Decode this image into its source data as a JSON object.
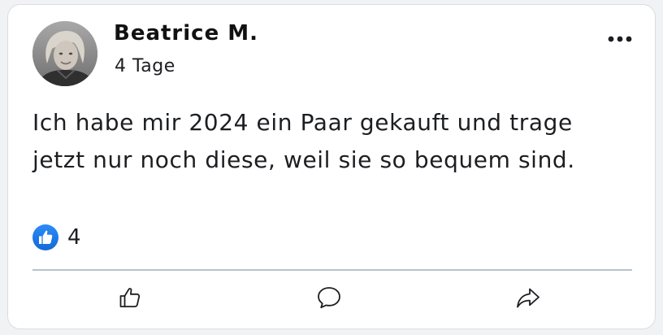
{
  "post": {
    "author": "Beatrice M.",
    "time": "4 Tage",
    "text": "Ich habe mir 2024 ein Paar gekauft und trage jetzt nur noch diese, weil sie so bequem sind.",
    "reaction_count": "4"
  },
  "icons": {
    "more": "more-horizontal-icon",
    "reaction": "like-reaction-icon",
    "like": "thumbs-up-icon",
    "comment": "comment-bubble-icon",
    "share": "share-arrow-icon"
  },
  "colors": {
    "like_blue": "#1877f2",
    "divider": "#b7c2c9",
    "text": "#1c1e21"
  }
}
